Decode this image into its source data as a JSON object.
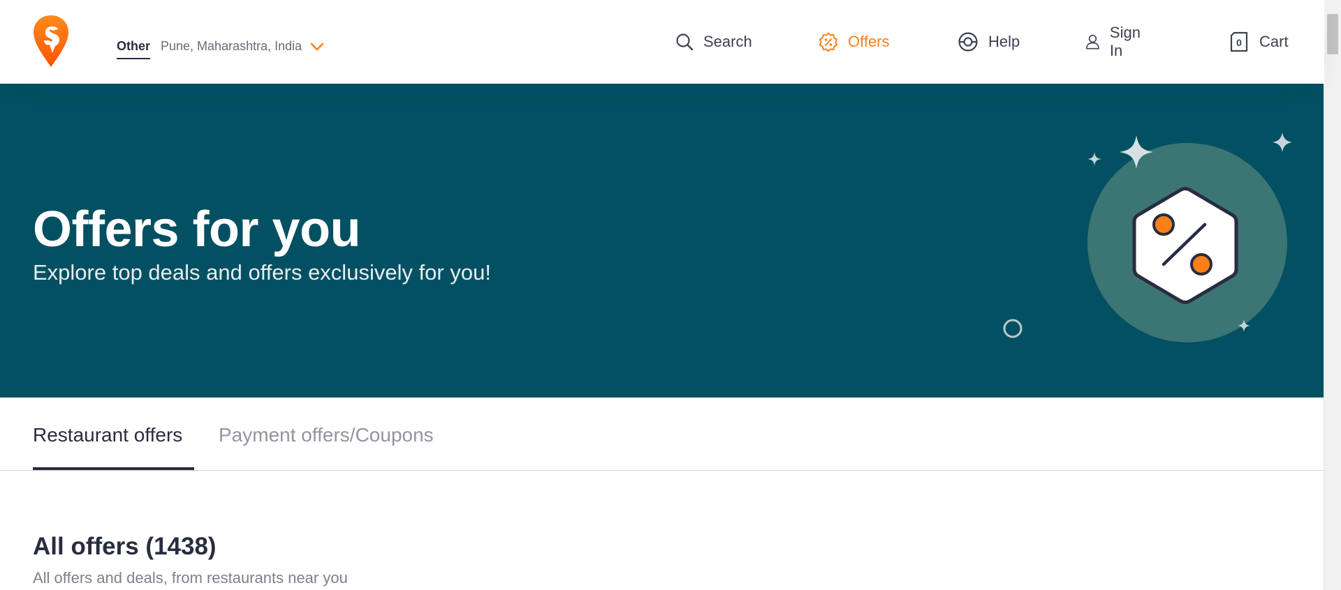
{
  "header": {
    "location_label": "Other",
    "location_text": "Pune, Maharashtra, India",
    "nav": [
      {
        "label": "Search",
        "icon": "search-icon"
      },
      {
        "label": "Offers",
        "icon": "offers-icon",
        "active": true
      },
      {
        "label": "Help",
        "icon": "help-icon"
      },
      {
        "label": "Sign In",
        "icon": "user-icon"
      },
      {
        "label": "Cart",
        "icon": "cart-icon",
        "count": "0"
      }
    ]
  },
  "hero": {
    "title": "Offers for you",
    "subtitle": "Explore top deals and offers exclusively for you!"
  },
  "tabs": [
    {
      "label": "Restaurant offers",
      "active": true
    },
    {
      "label": "Payment offers/Coupons",
      "active": false
    }
  ],
  "section": {
    "title": "All offers (1438)",
    "subtitle": "All offers and deals, from restaurants near you"
  },
  "colors": {
    "accent": "#fc8019",
    "hero_bg": "#035062",
    "text_dark": "#282c3f"
  }
}
